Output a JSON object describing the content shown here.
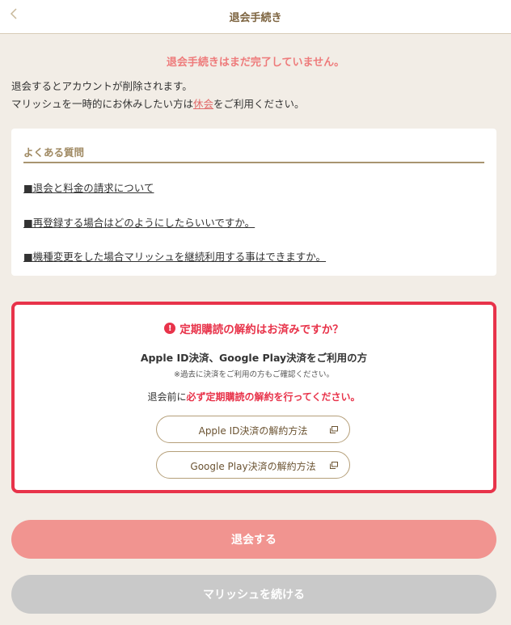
{
  "header": {
    "back_icon": "chevron-left-icon",
    "title": "退会手続き"
  },
  "notice": {
    "warning": "退会手続きはまだ完了していません。",
    "line1": "退会するとアカウントが削除されます。",
    "line2_before": "マリッシュを一時的にお休みしたい方は",
    "line2_link": "休会",
    "line2_after": "をご利用ください。"
  },
  "faq": {
    "heading": "よくある質問",
    "links": [
      "■退会と料金の請求について",
      "■再登録する場合はどのようにしたらいいですか。",
      "■機種変更をした場合マリッシュを継続利用する事はできますか。"
    ]
  },
  "subscription": {
    "alert_icon": "exclamation-circle-icon",
    "title": "定期購読の解約はお済みですか？",
    "line1": "Apple ID決済、Google Play決済をご利用の方",
    "note": "※過去に決済をご利用の方もご確認ください。",
    "line3_before": "退会前に",
    "line3_emphasis": "必ず定期購読の解約を行ってください。",
    "buttons": [
      {
        "label": "Apple ID決済の解約方法",
        "icon": "external-window-icon"
      },
      {
        "label": "Google Play決済の解約方法",
        "icon": "external-window-icon"
      }
    ]
  },
  "actions": {
    "withdraw_label": "退会する",
    "continue_label": "マリッシュを続ける"
  },
  "colors": {
    "background": "#f2ede6",
    "accent_brown": "#7d6440",
    "warning_pink": "#ee7b7b",
    "alert_red": "#e8334a",
    "primary_button": "#f19490",
    "secondary_button": "#c9c9c9"
  }
}
